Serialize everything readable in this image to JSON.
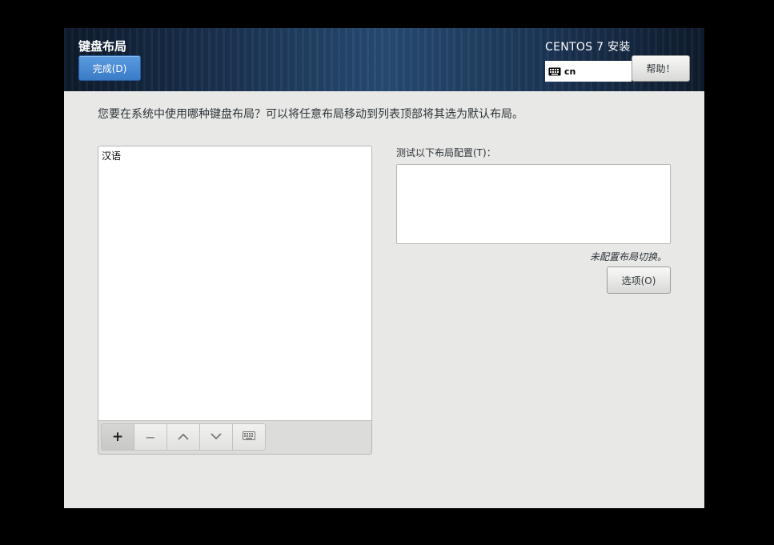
{
  "header": {
    "title": "键盘布局",
    "done_label": "完成(D)",
    "product": "CENTOS 7 安装",
    "keyboard_indicator": "cn",
    "help_label": "帮助！"
  },
  "main": {
    "question": "您要在系统中使用哪种键盘布局？可以将任意布局移动到列表顶部将其选为默认布局。",
    "layouts": [
      "汉语"
    ],
    "toolbar": {
      "add": "+",
      "remove": "−",
      "up_icon": "chevron-up-icon",
      "down_icon": "chevron-down-icon",
      "preview_icon": "keyboard-icon"
    },
    "test_label": "测试以下布局配置(T)：",
    "test_value": "",
    "no_switch": "未配置布局切换。",
    "options_label": "选项(O)"
  },
  "colors": {
    "done_button": "#3a7bc7",
    "header_bg": "#1a3250",
    "window_bg": "#e8e8e7"
  }
}
